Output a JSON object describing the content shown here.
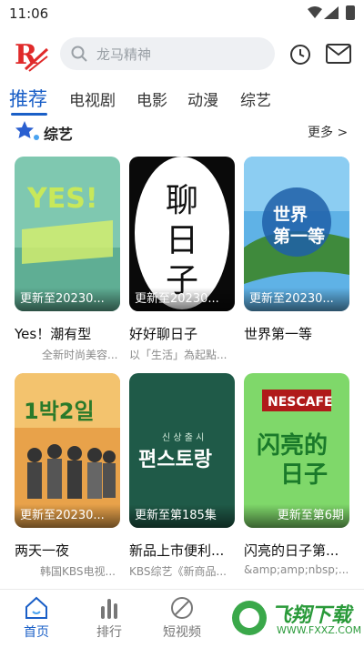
{
  "status_bar": {
    "time": "11:06"
  },
  "header": {
    "search_placeholder": "龙马精神"
  },
  "tabs": [
    {
      "label": "推荐",
      "active": true
    },
    {
      "label": "电视剧"
    },
    {
      "label": "电影"
    },
    {
      "label": "动漫"
    },
    {
      "label": "综艺"
    }
  ],
  "section": {
    "title": "综艺",
    "more": "更多 >"
  },
  "cards": [
    {
      "title": "Yes！潮有型",
      "subtitle": "全新时尚美容...",
      "update": "更新至20230...",
      "thumb_text": "YES!"
    },
    {
      "title": "好好聊日子",
      "subtitle": "以「生活」為起點...",
      "update": "更新至20230...",
      "thumb_text": "聊日子"
    },
    {
      "title": "世界第一等",
      "subtitle": "",
      "update": "更新至20230...",
      "thumb_text": "世界第一等"
    },
    {
      "title": "两天一夜",
      "subtitle": "韩国KBS电视...",
      "update": "更新至20230...",
      "thumb_text": "1박2일"
    },
    {
      "title": "新品上市便利...",
      "subtitle": "KBS综艺《新商品...",
      "update": "更新至第185集",
      "thumb_text": "편스토랑"
    },
    {
      "title": "闪亮的日子第...",
      "subtitle": "&amp;amp;nbsp;...",
      "update": "更新至第6期",
      "thumb_text": "NESCAFE"
    }
  ],
  "bottom_nav": [
    {
      "label": "首页",
      "active": true,
      "icon": "home-icon"
    },
    {
      "label": "排行",
      "icon": "ranking-icon"
    },
    {
      "label": "短视频",
      "icon": "short-video-icon"
    }
  ],
  "watermark": {
    "text": "飞翔下载",
    "sub": "WWW.FXXZ.COM"
  },
  "colors": {
    "accent": "#1a5fc7",
    "logo_red": "#e02a2a"
  }
}
